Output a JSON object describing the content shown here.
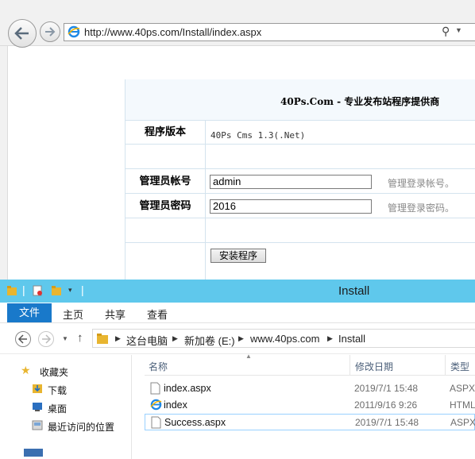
{
  "browser": {
    "url": "http://www.40ps.com/Install/index.aspx",
    "back_icon": "back-arrow-icon",
    "forward_icon": "forward-arrow-icon"
  },
  "install_form": {
    "title": "40Ps.Com - 专业发布站程序提供商",
    "version_label": "程序版本",
    "version_value": "40Ps Cms 1.3(.Net)",
    "admin_user_label": "管理员帐号",
    "admin_user_value": "admin",
    "admin_user_hint": "管理登录帐号。",
    "admin_pass_label": "管理员密码",
    "admin_pass_value": "2016",
    "admin_pass_hint": "管理登录密码。",
    "install_button": "安装程序"
  },
  "explorer": {
    "title": "Install",
    "accent_color": "#5fc8ec",
    "tabs": {
      "file": "文件",
      "home": "主页",
      "share": "共享",
      "view": "查看"
    },
    "breadcrumb": [
      "这台电脑",
      "新加卷 (E:)",
      "www.40ps.com",
      "Install"
    ],
    "sidebar": {
      "favorites": "收藏夹",
      "downloads": "下载",
      "desktop": "桌面",
      "recent": "最近访问的位置"
    },
    "columns": {
      "name": "名称",
      "modified": "修改日期",
      "type": "类型"
    },
    "files": [
      {
        "name": "index.aspx",
        "modified": "2019/7/1 15:48",
        "type": "ASPX",
        "icon": "file-icon"
      },
      {
        "name": "index",
        "modified": "2011/9/16 9:26",
        "type": "HTML",
        "icon": "ie-file-icon"
      },
      {
        "name": "Success.aspx",
        "modified": "2019/7/1 15:48",
        "type": "ASPX",
        "icon": "file-icon"
      }
    ]
  }
}
